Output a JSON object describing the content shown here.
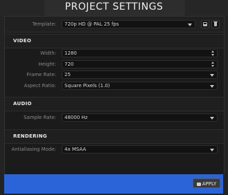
{
  "dialog": {
    "title": "PROJECT SETTINGS"
  },
  "template": {
    "label": "Template:",
    "value": "720p HD @ PAL 25 fps"
  },
  "video": {
    "section_title": "VIDEO",
    "width_label": "Width:",
    "width_value": "1280",
    "height_label": "Height:",
    "height_value": "720",
    "frame_rate_label": "Frame Rate:",
    "frame_rate_value": "25",
    "aspect_label": "Aspect Ratio:",
    "aspect_value": "Square Pixels (1.0)"
  },
  "audio": {
    "section_title": "AUDIO",
    "sample_rate_label": "Sample Rate:",
    "sample_rate_value": "48000 Hz"
  },
  "rendering": {
    "section_title": "RENDERING",
    "antialias_label": "Antialiasing Mode:",
    "antialias_value": "4x MSAA"
  },
  "footer": {
    "apply_label": "APPLY"
  },
  "icons": [
    "save-icon",
    "trash-icon",
    "spinner-icon",
    "chevron-down-icon",
    "apply-icon"
  ],
  "colors": {
    "accent": "#2a64d8",
    "background": "#1b1b1b"
  }
}
